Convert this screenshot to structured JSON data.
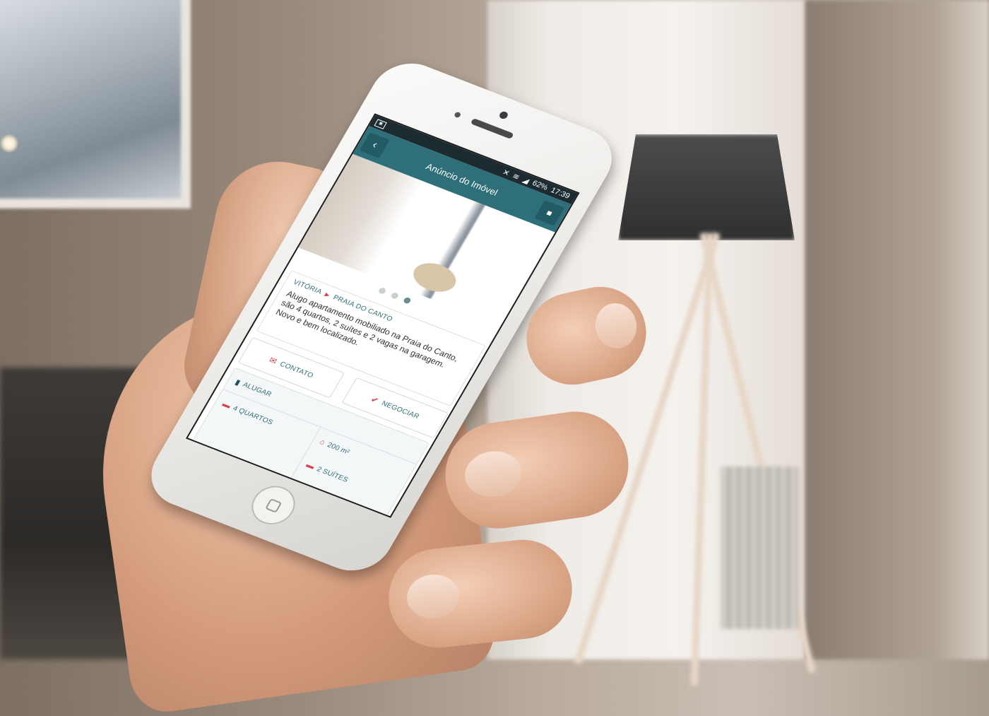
{
  "app": {
    "status_bar": {
      "battery": "62%",
      "time": "17:39"
    },
    "header": {
      "title": "Anúncio do Imóvel"
    },
    "carousel": {
      "total": 3,
      "active_index": 2
    },
    "listing": {
      "breadcrumb": [
        "VITÓRIA",
        "PRAIA DO CANTO"
      ],
      "description": "Alugo apartamento mobiliado na Praia do Canto, são 4 quartos, 2 suítes e 2 vagas na garagem. Novo e bem localizado."
    },
    "actions": {
      "contact_label": "CONTATO",
      "negotiate_label": "NEGOCIAR"
    },
    "features": {
      "type": "ALUGAR",
      "bedrooms": "4 QUARTOS",
      "area": "200 m²",
      "suites": "2 SUÍTES"
    },
    "colors": {
      "primary": "#2f6f7a",
      "accent": "#d8404f",
      "status_bar": "#1c2b30"
    }
  }
}
